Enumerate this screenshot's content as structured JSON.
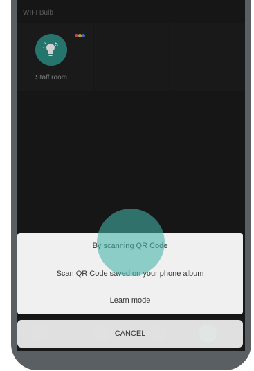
{
  "app": {
    "section_header": "WIFI Bulb"
  },
  "devices": [
    {
      "name": "Staff room",
      "icon": "lightbulb-icon",
      "status_dot_colors": [
        "#e0527a",
        "#f1c232",
        "#4a7fe0"
      ]
    }
  ],
  "action_sheet": {
    "options": [
      {
        "label": "By scanning QR Code"
      },
      {
        "label": "Scan QR Code saved on your phone album"
      },
      {
        "label": "Learn mode"
      }
    ],
    "cancel_label": "CANCEL"
  },
  "colors": {
    "accent": "#2f8f86",
    "screen_background": "#1b1b1b",
    "sheet_background": "#f0f0f0"
  }
}
